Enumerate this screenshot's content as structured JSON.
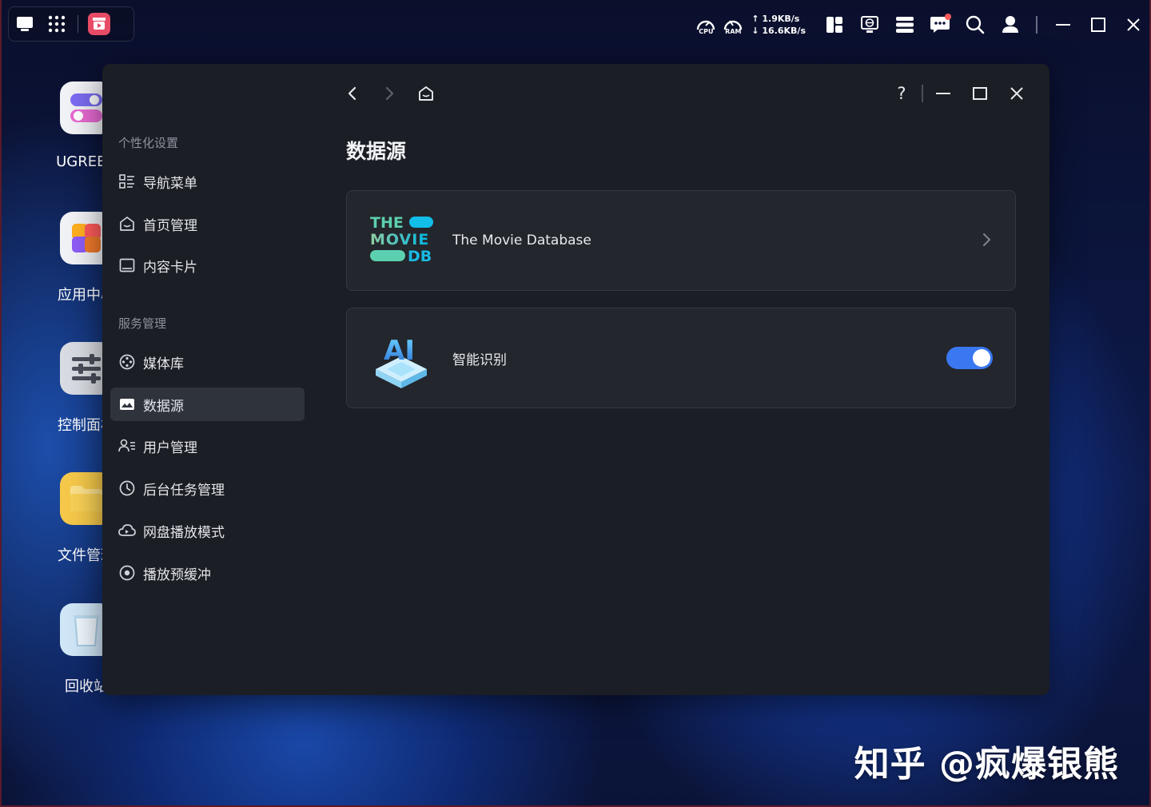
{
  "topbar": {
    "cpu_label": "CPU",
    "ram_label": "RAM",
    "net_up": "↑ 1.9KB/s",
    "net_down": "↓ 16.6KB/s"
  },
  "desktop": {
    "icons": [
      {
        "label": "UGREEN"
      },
      {
        "label": "应用中心"
      },
      {
        "label": "控制面板"
      },
      {
        "label": "文件管理"
      },
      {
        "label": "回收站"
      }
    ]
  },
  "sidebar": {
    "section1_title": "个性化设置",
    "section2_title": "服务管理",
    "items": [
      {
        "label": "导航菜单"
      },
      {
        "label": "首页管理"
      },
      {
        "label": "内容卡片"
      },
      {
        "label": "媒体库"
      },
      {
        "label": "数据源"
      },
      {
        "label": "用户管理"
      },
      {
        "label": "后台任务管理"
      },
      {
        "label": "网盘播放模式"
      },
      {
        "label": "播放预缓冲"
      }
    ],
    "active_item": "数据源"
  },
  "main": {
    "title": "数据源",
    "help_label": "?",
    "cards": [
      {
        "name": "The Movie Database",
        "logo_text": [
          "THE",
          "MOVIE",
          "DB"
        ]
      },
      {
        "name": "智能识别",
        "logo_text": "AI",
        "enabled": true
      }
    ]
  },
  "watermark": "知乎 @疯爆银熊",
  "colors": {
    "accent": "#3a78f2",
    "window_bg": "#1b1e24",
    "card_bg": "#23262c",
    "tmdb_teal": "#39c9b6",
    "tmdb_blue": "#0db7e4"
  }
}
